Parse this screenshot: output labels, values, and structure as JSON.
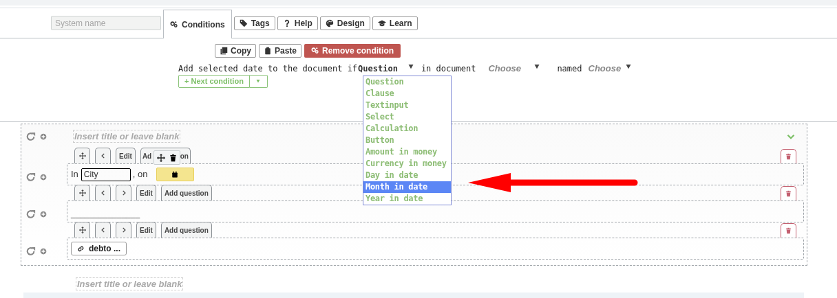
{
  "header": {
    "system_name_placeholder": "System name",
    "tabs": [
      {
        "label": "Conditions",
        "selected": true
      },
      {
        "label": "Tags",
        "selected": false
      },
      {
        "label": "Help",
        "selected": false
      },
      {
        "label": "Design",
        "selected": false
      },
      {
        "label": "Learn",
        "selected": false
      }
    ]
  },
  "condition": {
    "actions": [
      {
        "label": "Copy",
        "kind": "default"
      },
      {
        "label": "Paste",
        "kind": "default"
      },
      {
        "label": "Remove condition",
        "kind": "danger"
      }
    ],
    "sentence": {
      "prefix": "Add selected date to the document if",
      "type_select": "Question",
      "in_document": "in document",
      "document_select": "Choose",
      "named": "named",
      "name_select": "Choose"
    },
    "next_condition": "+ Next condition",
    "dropdown": {
      "expanded": true,
      "options": [
        {
          "label": "Question",
          "selected": false
        },
        {
          "label": "Clause",
          "selected": false
        },
        {
          "label": "Textinput",
          "selected": false
        },
        {
          "label": "Select",
          "selected": false
        },
        {
          "label": "Calculation",
          "selected": false
        },
        {
          "label": "Button",
          "selected": false
        },
        {
          "label": "Amount in money",
          "selected": false
        },
        {
          "label": "Currency in money",
          "selected": false
        },
        {
          "label": "Day in date",
          "selected": false
        },
        {
          "label": "Month in date",
          "selected": true
        },
        {
          "label": "Year in date",
          "selected": false
        }
      ]
    }
  },
  "section": {
    "title_placeholder": "Insert title or leave blank",
    "collapsed": false,
    "rows": [
      {
        "tools": [
          {
            "kind": "move"
          },
          {
            "kind": "prev"
          },
          {
            "kind": "text",
            "label": "Edit"
          },
          {
            "kind": "covered",
            "parts": [
              "Ad",
              "on"
            ]
          }
        ],
        "popover": true,
        "content": {
          "kind": "location_date",
          "in_label": "In",
          "city": "City",
          "on_label": ", on"
        }
      },
      {
        "tools": [
          {
            "kind": "move"
          },
          {
            "kind": "prev"
          },
          {
            "kind": "next"
          },
          {
            "kind": "text",
            "label": "Edit"
          },
          {
            "kind": "text",
            "label": "Add question"
          }
        ],
        "popover": false,
        "content": {
          "kind": "blank",
          "text": "_______________"
        }
      },
      {
        "tools": [
          {
            "kind": "move"
          },
          {
            "kind": "prev"
          },
          {
            "kind": "next"
          },
          {
            "kind": "text",
            "label": "Edit"
          },
          {
            "kind": "text",
            "label": "Add question"
          }
        ],
        "popover": false,
        "content": {
          "kind": "link_button",
          "label": "debto ..."
        }
      }
    ]
  },
  "next_title_placeholder": "Insert title or leave blank"
}
